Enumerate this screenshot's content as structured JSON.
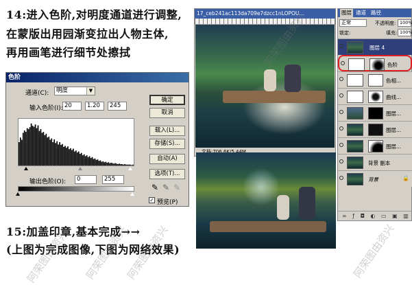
{
  "instructions": {
    "line1": "14:进入色阶,对明度通道进行调整,",
    "line2": "在蒙版出用园渐变拉出人物主体,",
    "line3": "再用画笔进行细节处擦拭",
    "line4": "15:加盖印章,基本完成→→",
    "line5": "(上图为完成图像,下图为网络效果)"
  },
  "levels_dialog": {
    "title": "色阶",
    "channel_label": "通道(C):",
    "channel_value": "明度",
    "input_label": "输入色阶(I):",
    "input_values": [
      "20",
      "1.20",
      "245"
    ],
    "output_label": "输出色阶(O):",
    "output_values": [
      "0",
      "255"
    ],
    "buttons": [
      "确定",
      "取消",
      "载入(L)...",
      "存储(S)...",
      "自动(A)",
      "选项(T)..."
    ],
    "preview_label": "预览(P)",
    "preview_checked": true,
    "histogram_levels": [
      0.5,
      0.6,
      0.55,
      0.7,
      0.75,
      0.72,
      0.8,
      0.78,
      0.82,
      0.9,
      0.85,
      0.83,
      0.88,
      0.8,
      0.86,
      0.74,
      0.78,
      0.7,
      0.72,
      0.65,
      0.68,
      0.6,
      0.62,
      0.55,
      0.58,
      0.5,
      0.56,
      0.48,
      0.52,
      0.45,
      0.5,
      0.44,
      0.46,
      0.4,
      0.42,
      0.38,
      0.41,
      0.35,
      0.37,
      0.33,
      0.36,
      0.3,
      0.32,
      0.28,
      0.3,
      0.25,
      0.27,
      0.22,
      0.24,
      0.2,
      0.22,
      0.18,
      0.2,
      0.16,
      0.18,
      0.14,
      0.15,
      0.12,
      0.13,
      0.1,
      0.11,
      0.08,
      0.09,
      0.07,
      0.08,
      0.06,
      0.07,
      0.05,
      0.06,
      0.05,
      0.04,
      0.05,
      0.04,
      0.03,
      0.04,
      0.03,
      0.03,
      0.02,
      0.03,
      0.02,
      0.02,
      0.02,
      0.02,
      0.01,
      0.02
    ]
  },
  "ps_window": {
    "title": "17_ceb241ac113da709e7dzcc1nLOPOU...",
    "status": "文档:706.6K/5.44M"
  },
  "layers_panel": {
    "tabs": [
      "图层",
      "通道",
      "路径"
    ],
    "blend_mode": "正常",
    "opacity_label": "不透明度:",
    "opacity_value": "100%",
    "lock_label": "锁定:",
    "fill_label": "填充:",
    "fill_value": "100%",
    "layers": [
      {
        "name": "图层 4",
        "selected": true
      },
      {
        "name": "色阶",
        "selected": false
      },
      {
        "name": "色相...",
        "selected": false
      },
      {
        "name": "曲线...",
        "selected": false
      },
      {
        "name": "图层...",
        "selected": false
      },
      {
        "name": "图层...",
        "selected": false
      },
      {
        "name": "图层...",
        "selected": false
      },
      {
        "name": "背景 副本",
        "selected": false
      },
      {
        "name": "背景",
        "selected": false
      }
    ]
  },
  "colors": {
    "title_bar": "#0a246a",
    "panel_bg": "#d4d0c8",
    "selection_highlight": "#e02020"
  },
  "watermark": "阿荣图由资兴"
}
